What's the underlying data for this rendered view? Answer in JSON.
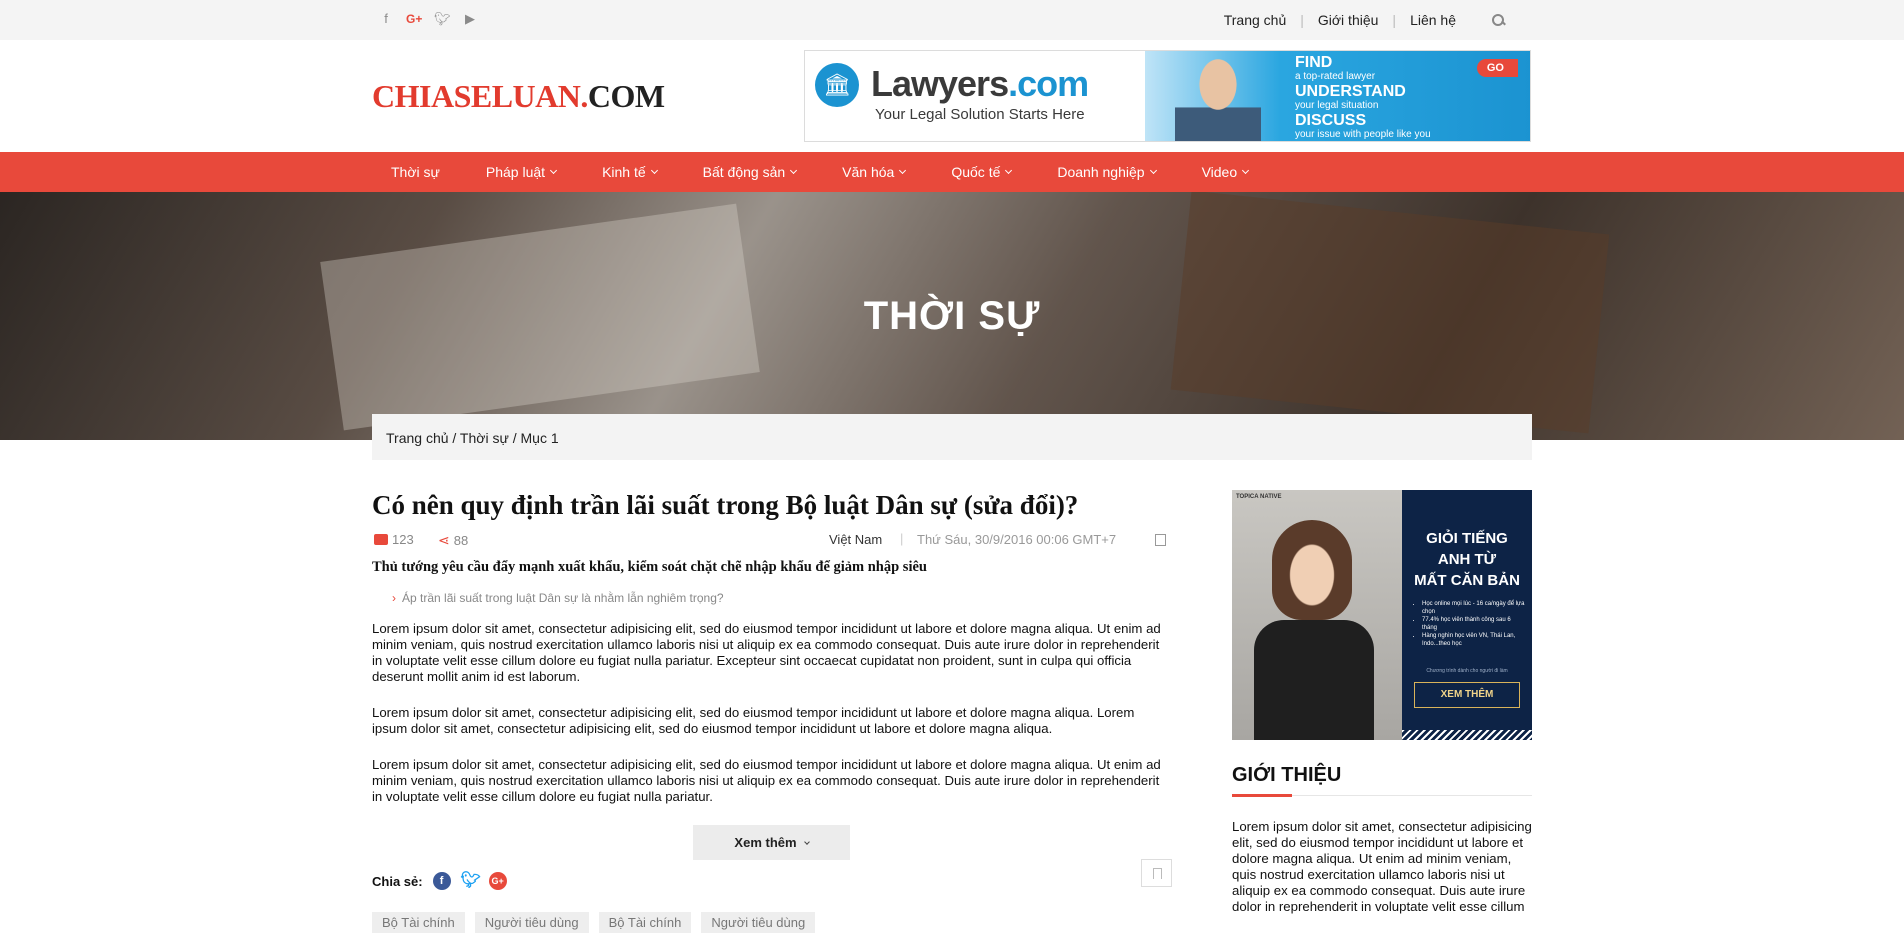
{
  "topbar": {
    "social": [
      "facebook-icon",
      "google-plus-icon",
      "twitter-icon",
      "youtube-icon"
    ],
    "links": [
      "Trang chủ",
      "Giới thiệu",
      "Liên hệ"
    ]
  },
  "header": {
    "logo_main": "CHIASELUAN",
    "logo_tld": ".COM",
    "banner": {
      "brand_a": "Lawyers",
      "brand_b": ".com",
      "tagline": "Your Legal Solution Starts Here",
      "find": "FIND",
      "find_sub": "a top-rated lawyer",
      "understand": "UNDERSTAND",
      "understand_sub": "your legal situation",
      "discuss": "DISCUSS",
      "discuss_sub": "your issue with people like you",
      "go": "GO"
    }
  },
  "nav": {
    "items": [
      {
        "label": "Thời sự",
        "dropdown": false
      },
      {
        "label": "Pháp luật",
        "dropdown": true
      },
      {
        "label": "Kinh tế",
        "dropdown": true
      },
      {
        "label": "Bất động sản",
        "dropdown": true
      },
      {
        "label": "Văn hóa",
        "dropdown": true
      },
      {
        "label": "Quốc tế",
        "dropdown": true
      },
      {
        "label": "Doanh nghiệp",
        "dropdown": true
      },
      {
        "label": "Video",
        "dropdown": true
      }
    ]
  },
  "hero": {
    "title": "THỜI SỰ"
  },
  "breadcrumb": "Trang chủ / Thời sự / Mục 1",
  "article": {
    "title": "Có nên quy định trần lãi suất trong Bộ luật Dân sự (sửa đổi)?",
    "comments": "123",
    "shares": "88",
    "region": "Việt Nam",
    "separator": "|",
    "date": "Thứ Sáu, 30/9/2016 00:06 GMT+7",
    "lead": "Thủ tướng yêu cầu đẩy mạnh xuất khẩu, kiểm soát chặt chẽ nhập khẩu để giảm nhập siêu",
    "related": "Áp trần lãi suất trong luật Dân sự là nhằm lẫn nghiêm trọng?",
    "paragraphs": [
      "Lorem ipsum dolor sit amet, consectetur adipisicing elit, sed do eiusmod tempor incididunt ut labore et dolore magna aliqua. Ut enim ad minim veniam, quis nostrud exercitation ullamco laboris nisi ut aliquip ex ea commodo consequat. Duis aute irure dolor in reprehenderit in voluptate velit esse cillum dolore eu fugiat nulla pariatur. Excepteur sint occaecat cupidatat non proident, sunt in culpa qui officia deserunt mollit anim id est laborum.",
      "Lorem ipsum dolor sit amet, consectetur adipisicing elit, sed do eiusmod tempor incididunt ut labore et dolore magna aliqua. Lorem ipsum dolor sit amet, consectetur adipisicing elit, sed do eiusmod tempor incididunt ut labore et dolore magna aliqua.",
      "Lorem ipsum dolor sit amet, consectetur adipisicing elit, sed do eiusmod tempor incididunt ut labore et dolore magna aliqua. Ut enim ad minim veniam, quis nostrud exercitation ullamco laboris nisi ut aliquip ex ea commodo consequat. Duis aute irure dolor in reprehenderit in voluptate velit esse cillum dolore eu fugiat nulla pariatur."
    ],
    "more": "Xem thêm",
    "share_label": "Chia sẻ:",
    "tags": [
      "Bộ Tài chính",
      "Người tiêu dùng",
      "Bộ Tài chính",
      "Người tiêu dùng"
    ]
  },
  "sidebar": {
    "ad": {
      "brand": "TOPICA NATIVE",
      "headline": [
        "GIỎI TIẾNG",
        "ANH TỪ",
        "MẤT CĂN BẢN"
      ],
      "bullets": [
        "Học online mọi lúc - 16 ca/ngày để lựa chọn",
        "77.4% học viên thành công sau 6 tháng",
        "Hàng nghìn học viên VN, Thái Lan, Indo...theo học"
      ],
      "note": "Chương trình dành cho người đi làm",
      "button": "XEM THÊM"
    },
    "about_title": "GIỚI THIỆU",
    "about_text": "Lorem ipsum dolor sit amet, consectetur adipisicing elit, sed do eiusmod tempor incididunt ut labore et dolore magna aliqua. Ut enim ad minim veniam, quis nostrud exercitation ullamco laboris nisi ut aliquip ex ea commodo consequat. Duis aute irure dolor in reprehenderit in voluptate velit esse cillum"
  }
}
